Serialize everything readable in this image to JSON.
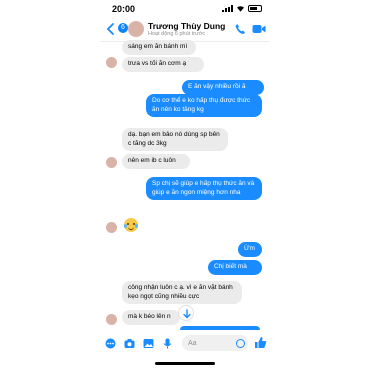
{
  "status_bar": {
    "time": "20:00"
  },
  "header": {
    "back_badge": "6",
    "contact_name": "Trương Thùy Dung",
    "contact_status": "Hoạt động 6 phút trước"
  },
  "messages": [
    {
      "direction": "in",
      "text": "sáng em ăn bánh mì"
    },
    {
      "direction": "in",
      "text": "trưa vs tối ăn cơm ạ"
    },
    {
      "direction": "out",
      "text": "E ăn vậy nhiều rồi ă"
    },
    {
      "direction": "out",
      "text": "Do cơ thể e ko hấp thụ được thức ăn nên ko tăng kg"
    },
    {
      "direction": "in",
      "text": "dạ. bạn em bảo nó dùng sp bên c tăng dc 3kg"
    },
    {
      "direction": "in",
      "text": "nên em ib c luôn"
    },
    {
      "direction": "out",
      "text": "Sp chị sẽ giúp e hấp thụ thức ăn và giúp e ăn ngon miệng hơn nha"
    },
    {
      "direction": "out",
      "text": "Ừm"
    },
    {
      "direction": "out",
      "text": "Chị biết mà"
    },
    {
      "direction": "in",
      "text": "công nhận luôn c ạ. vì e ăn vặt bánh kẹo ngọt cũng nhiều cực"
    },
    {
      "direction": "in",
      "text": "mà k béo lên n"
    }
  ],
  "reaction": {
    "emoji": "crying-laughing-emoji"
  },
  "composer": {
    "placeholder": "Aa"
  },
  "colors": {
    "accent": "#1a8cff",
    "incoming_bubble": "#ebebeb",
    "outgoing_bubble": "#1a8cff"
  }
}
